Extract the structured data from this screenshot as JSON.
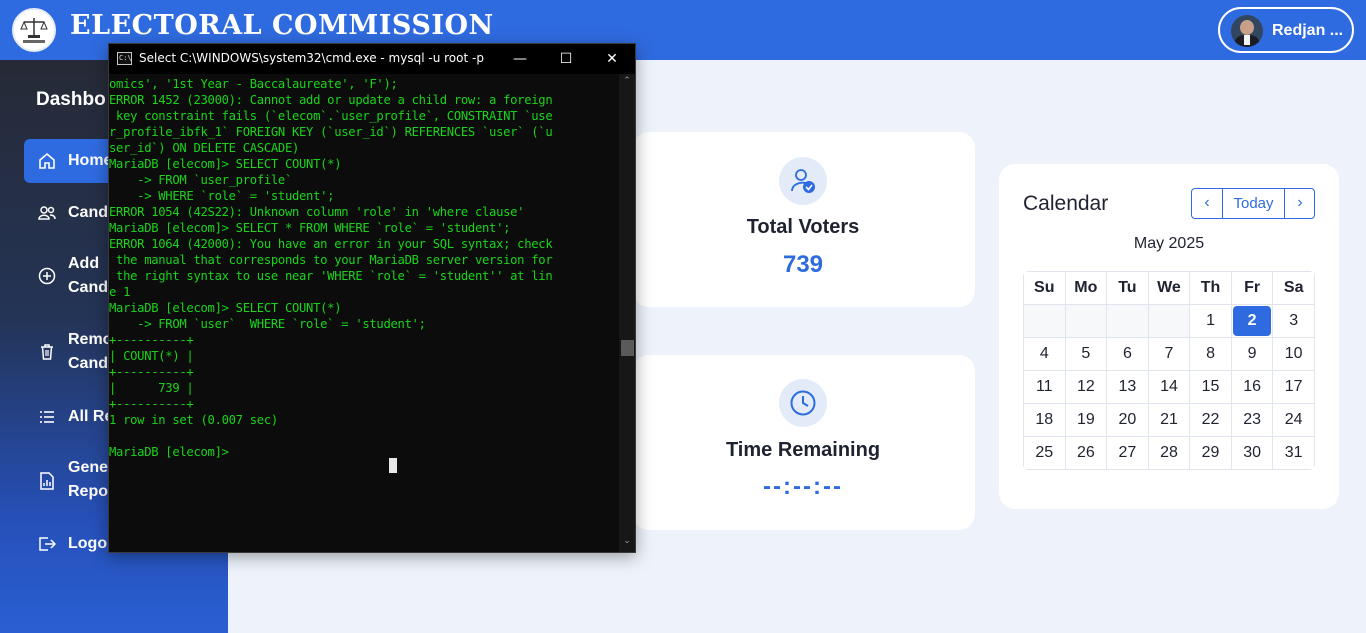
{
  "header": {
    "title": "ELECTORAL COMMISSION",
    "user_name": "Redjan ..."
  },
  "sidebar": {
    "title": "Dashbo",
    "items": [
      {
        "label": "Home",
        "icon": "home-icon"
      },
      {
        "label": "Cand",
        "icon": "users-icon"
      },
      {
        "label": "Add\nCand",
        "icon": "add-circle-icon"
      },
      {
        "label": "Remo\nCand",
        "icon": "trash-icon"
      },
      {
        "label": "All Re",
        "icon": "list-icon"
      },
      {
        "label": "Gene\nRepo",
        "icon": "report-icon"
      },
      {
        "label": "Logou",
        "icon": "logout-icon"
      }
    ]
  },
  "stats": {
    "voters": {
      "label": "Total Voters",
      "value": "739",
      "icon": "user-check-icon"
    },
    "time": {
      "label": "Time Remaining",
      "value": "--:--:--",
      "icon": "clock-icon"
    }
  },
  "calendar": {
    "title": "Calendar",
    "today_label": "Today",
    "month": "May 2025",
    "weekdays": [
      "Su",
      "Mo",
      "Tu",
      "We",
      "Th",
      "Fr",
      "Sa"
    ],
    "weeks": [
      [
        "",
        "",
        "",
        "",
        "1",
        "2",
        "3"
      ],
      [
        "4",
        "5",
        "6",
        "7",
        "8",
        "9",
        "10"
      ],
      [
        "11",
        "12",
        "13",
        "14",
        "15",
        "16",
        "17"
      ],
      [
        "18",
        "19",
        "20",
        "21",
        "22",
        "23",
        "24"
      ],
      [
        "25",
        "26",
        "27",
        "28",
        "29",
        "30",
        "31"
      ]
    ],
    "today": "2",
    "accent": "#2f6be0"
  },
  "console": {
    "title": "Select C:\\WINDOWS\\system32\\cmd.exe - mysql  -u root -p",
    "text_color": "#19d419",
    "lines": [
      "omics', '1st Year - Baccalaureate', 'F');",
      "ERROR 1452 (23000): Cannot add or update a child row: a foreign",
      " key constraint fails (`elecom`.`user_profile`, CONSTRAINT `use",
      "r_profile_ibfk_1` FOREIGN KEY (`user_id`) REFERENCES `user` (`u",
      "ser_id`) ON DELETE CASCADE)",
      "MariaDB [elecom]> SELECT COUNT(*)",
      "    -> FROM `user_profile`",
      "    -> WHERE `role` = 'student';",
      "ERROR 1054 (42S22): Unknown column 'role' in 'where clause'",
      "MariaDB [elecom]> SELECT * FROM WHERE `role` = 'student';",
      "ERROR 1064 (42000): You have an error in your SQL syntax; check",
      " the manual that corresponds to your MariaDB server version for",
      " the right syntax to use near 'WHERE `role` = 'student'' at lin",
      "e 1",
      "MariaDB [elecom]> SELECT COUNT(*)",
      "    -> FROM `user`  WHERE `role` = 'student';",
      "+----------+",
      "| COUNT(*) |",
      "+----------+",
      "|      739 |",
      "+----------+",
      "1 row in set (0.007 sec)",
      "",
      "MariaDB [elecom]>"
    ]
  }
}
